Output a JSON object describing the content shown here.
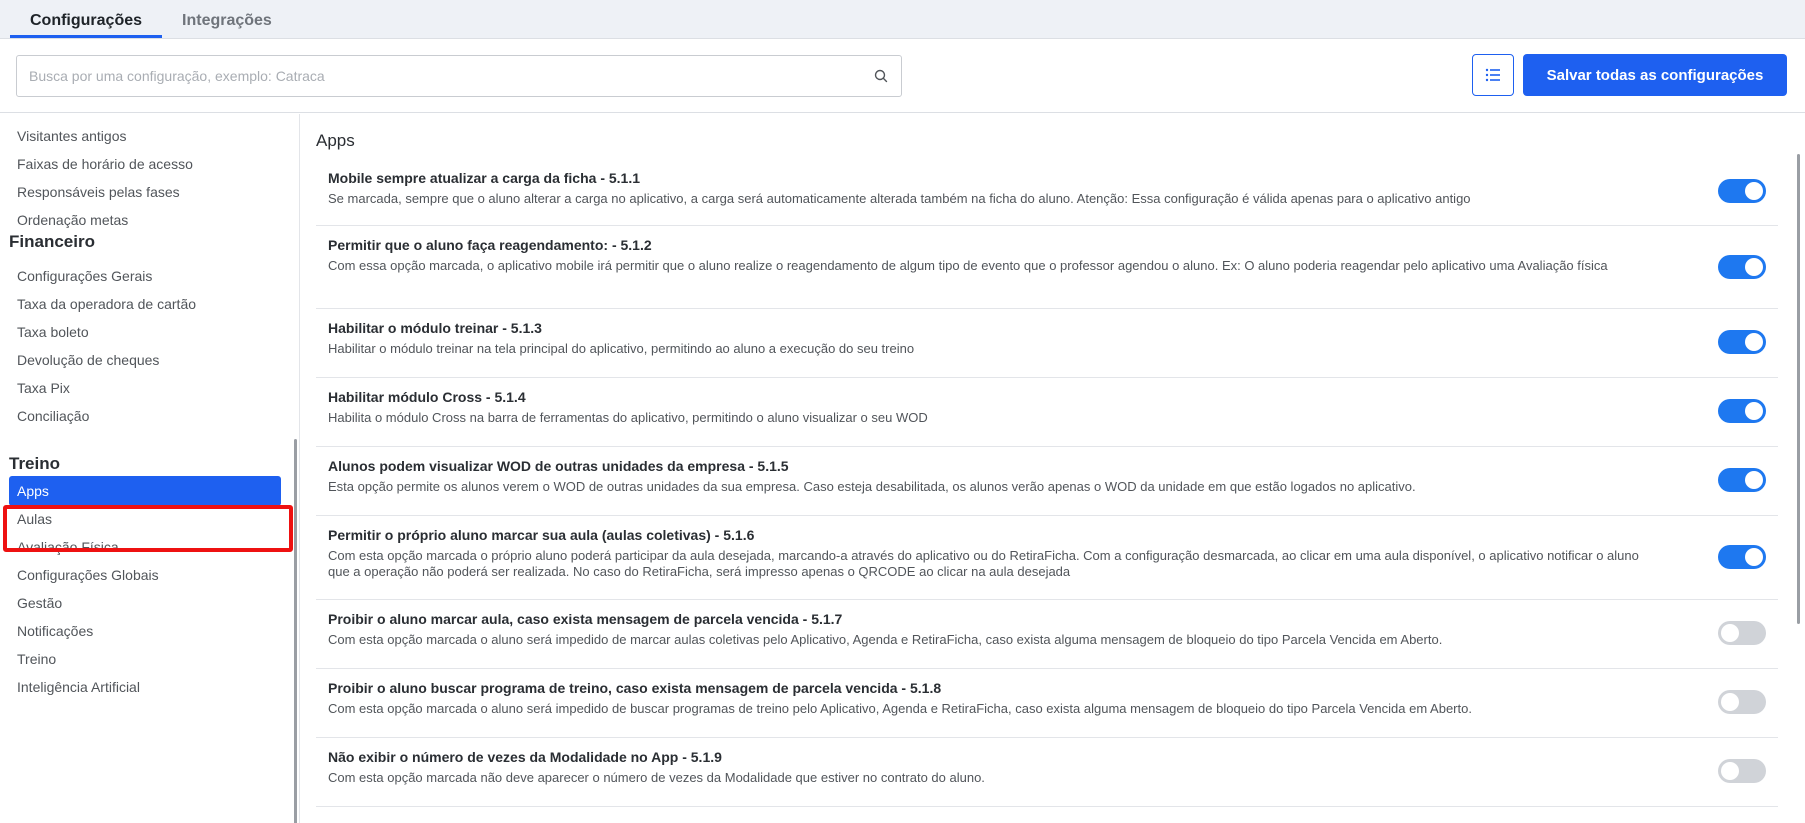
{
  "tabs": [
    {
      "label": "Configurações",
      "active": true
    },
    {
      "label": "Integrações",
      "active": false
    }
  ],
  "search": {
    "placeholder": "Busca por uma configuração, exemplo: Catraca",
    "value": ""
  },
  "toolbar": {
    "list_icon": "list-icon",
    "save_label": "Salvar todas as configurações"
  },
  "colors": {
    "accent": "#1e60f0",
    "toggle_on": "#1e78f0",
    "toggle_off": "#d0d3d8",
    "highlight": "#ee1111"
  },
  "sidebar": {
    "items_top": [
      "Visitantes antigos",
      "Faixas de horário de acesso",
      "Responsáveis pelas fases",
      "Ordenação metas"
    ],
    "financeiro": {
      "heading": "Financeiro",
      "items": [
        "Configurações Gerais",
        "Taxa da operadora de cartão",
        "Taxa boleto",
        "Devolução de cheques",
        "Taxa Pix",
        "Conciliação"
      ]
    },
    "treino": {
      "heading": "Treino",
      "items": [
        "Apps",
        "Aulas",
        "Avaliação Física",
        "Configurações Globais",
        "Gestão",
        "Notificações",
        "Treino",
        "Inteligência Artificial"
      ]
    },
    "selected": "Apps"
  },
  "main": {
    "title": "Apps",
    "settings": [
      {
        "title": "Mobile sempre atualizar a carga da ficha - 5.1.1",
        "desc": "Se marcada, sempre que o aluno alterar a carga no aplicativo, a carga será automaticamente alterada também na ficha do aluno. Atenção: Essa configuração é válida apenas para o aplicativo antigo",
        "enabled": true
      },
      {
        "title": "Permitir que o aluno faça reagendamento: - 5.1.2",
        "desc": "Com essa opção marcada, o aplicativo mobile irá permitir que o aluno realize o reagendamento de algum tipo de evento que o professor agendou o aluno. Ex: O aluno poderia reagendar pelo aplicativo uma Avaliação física",
        "enabled": true
      },
      {
        "title": "Habilitar o módulo treinar - 5.1.3",
        "desc": "Habilitar o módulo treinar na tela principal do aplicativo, permitindo ao aluno a execução do seu treino",
        "enabled": true
      },
      {
        "title": "Habilitar módulo Cross - 5.1.4",
        "desc": "Habilita o módulo Cross na barra de ferramentas do aplicativo, permitindo o aluno visualizar o seu WOD",
        "enabled": true
      },
      {
        "title": "Alunos podem visualizar WOD de outras unidades da empresa - 5.1.5",
        "desc": "Esta opção permite os alunos verem o WOD de outras unidades da sua empresa. Caso esteja desabilitada, os alunos verão apenas o WOD da unidade em que estão logados no aplicativo.",
        "enabled": true
      },
      {
        "title": "Permitir o próprio aluno marcar sua aula (aulas coletivas) - 5.1.6",
        "desc": "Com esta opção marcada o próprio aluno poderá participar da aula desejada, marcando-a através do aplicativo ou do RetiraFicha. Com a configuração desmarcada, ao clicar em uma aula disponível, o aplicativo notificar o aluno que a operação não poderá ser realizada. No caso do RetiraFicha, será impresso apenas o QRCODE ao clicar na aula desejada",
        "enabled": true
      },
      {
        "title": "Proibir o aluno marcar aula, caso exista mensagem de parcela vencida - 5.1.7",
        "desc": "Com esta opção marcada o aluno será impedido de marcar aulas coletivas pelo Aplicativo, Agenda e RetiraFicha, caso exista alguma mensagem de bloqueio do tipo Parcela Vencida em Aberto.",
        "enabled": false
      },
      {
        "title": "Proibir o aluno buscar programa de treino, caso exista mensagem de parcela vencida - 5.1.8",
        "desc": "Com esta opção marcada o aluno será impedido de buscar programas de treino pelo Aplicativo, Agenda e RetiraFicha, caso exista alguma mensagem de bloqueio do tipo Parcela Vencida em Aberto.",
        "enabled": false
      },
      {
        "title": "Não exibir o número de vezes da Modalidade no App - 5.1.9",
        "desc": "Com esta opção marcada não deve aparecer o número de vezes da Modalidade que estiver no contrato do aluno.",
        "enabled": false
      }
    ]
  }
}
